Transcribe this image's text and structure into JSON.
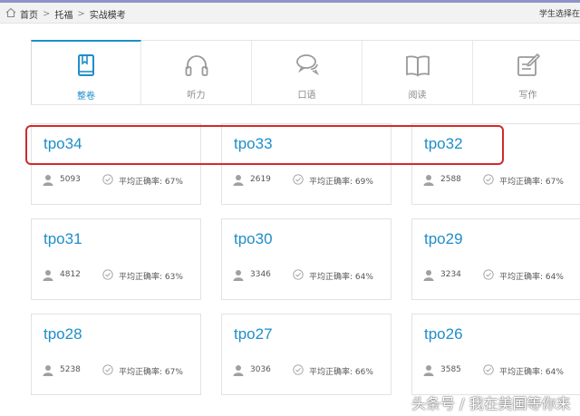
{
  "breadcrumb": {
    "items": [
      {
        "label": "首页",
        "icon": "home-icon"
      },
      {
        "label": "托福"
      },
      {
        "label": "实战模考"
      }
    ],
    "separator": ">"
  },
  "header": {
    "student_text": "学生选择在"
  },
  "tabs": [
    {
      "label": "整卷",
      "icon": "book-icon",
      "active": true
    },
    {
      "label": "听力",
      "icon": "headphones-icon",
      "active": false
    },
    {
      "label": "口语",
      "icon": "speech-bubbles-icon",
      "active": false
    },
    {
      "label": "阅读",
      "icon": "open-book-icon",
      "active": false
    },
    {
      "label": "写作",
      "icon": "edit-icon",
      "active": false
    }
  ],
  "tests": [
    {
      "name": "tpo34",
      "count": "5093",
      "accuracy_label": "平均正确率:",
      "accuracy": "67%"
    },
    {
      "name": "tpo33",
      "count": "2619",
      "accuracy_label": "平均正确率:",
      "accuracy": "69%"
    },
    {
      "name": "tpo32",
      "count": "2588",
      "accuracy_label": "平均正确率:",
      "accuracy": "67%"
    },
    {
      "name": "tpo31",
      "count": "4812",
      "accuracy_label": "平均正确率:",
      "accuracy": "63%"
    },
    {
      "name": "tpo30",
      "count": "3346",
      "accuracy_label": "平均正确率:",
      "accuracy": "64%"
    },
    {
      "name": "tpo29",
      "count": "3234",
      "accuracy_label": "平均正确率:",
      "accuracy": "64%"
    },
    {
      "name": "tpo28",
      "count": "5238",
      "accuracy_label": "平均正确率:",
      "accuracy": "67%"
    },
    {
      "name": "tpo27",
      "count": "3036",
      "accuracy_label": "平均正确率:",
      "accuracy": "66%"
    },
    {
      "name": "tpo26",
      "count": "3585",
      "accuracy_label": "平均正确率:",
      "accuracy": "64%"
    }
  ],
  "watermark": "头条号 / 我在美国等你来",
  "colors": {
    "accent": "#1f8ec9",
    "highlight": "#cf2b2b",
    "muted_icon": "#9a9a9a"
  }
}
